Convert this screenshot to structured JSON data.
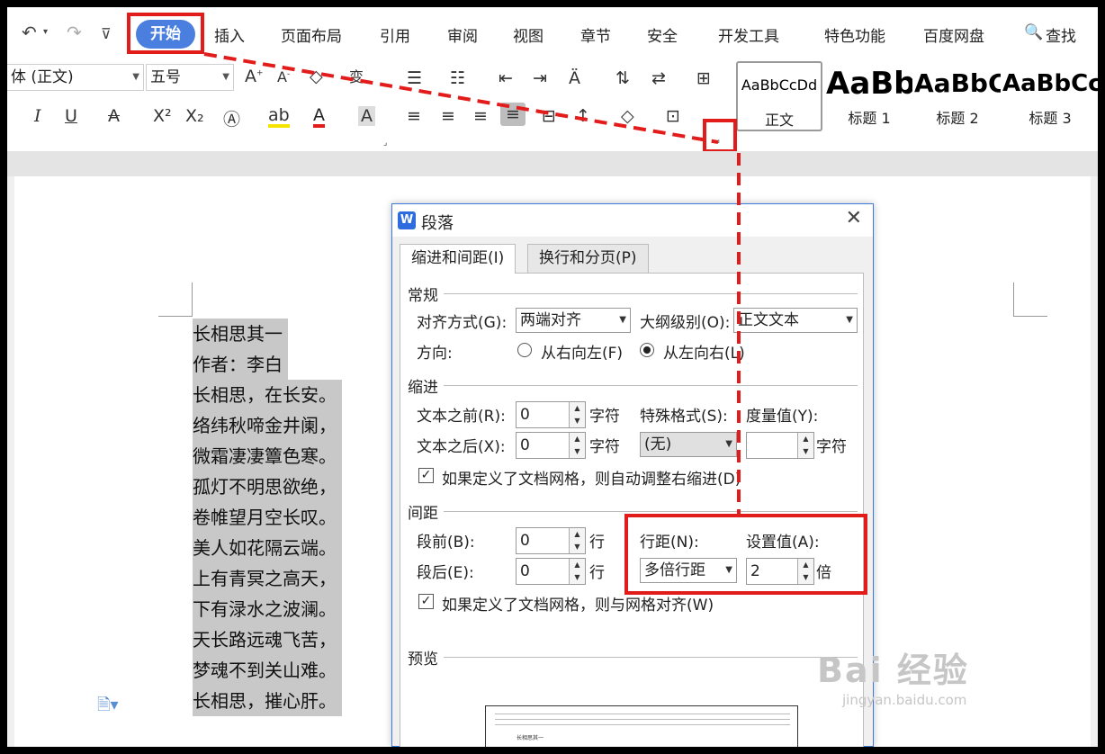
{
  "ribbon_tabs": {
    "home": "开始",
    "others": [
      "插入",
      "页面布局",
      "引用",
      "审阅",
      "视图",
      "章节",
      "安全",
      "开发工具",
      "特色功能",
      "百度网盘"
    ],
    "search": "查找"
  },
  "quick_access": {
    "undo": "↶",
    "redo": "↷",
    "more": "⊽"
  },
  "font": {
    "family": "体 (正文)",
    "size": "五号"
  },
  "styles": [
    {
      "sample": "AaBbCcDd",
      "name": "正文"
    },
    {
      "sample": "AaBb",
      "name": "标题 1"
    },
    {
      "sample": "AaBbC",
      "name": "标题 2"
    },
    {
      "sample": "AaBbCc",
      "name": "标题 3"
    }
  ],
  "poem": [
    "长相思其一",
    "作者：李白",
    "长相思，在长安。",
    "络纬秋啼金井阑，",
    "微霜凄凄簟色寒。",
    "孤灯不明思欲绝，",
    "卷帷望月空长叹。",
    "美人如花隔云端。",
    "上有青冥之高天，",
    "下有渌水之波澜。",
    "天长路远魂飞苦，",
    "梦魂不到关山难。",
    "长相思，摧心肝。"
  ],
  "dialog": {
    "title": "段落",
    "logo": "W",
    "close": "✕",
    "tabs": [
      "缩进和间距(I)",
      "换行和分页(P)"
    ],
    "general": {
      "header": "常规",
      "align_label": "对齐方式(G):",
      "align_value": "两端对齐",
      "outline_label": "大纲级别(O):",
      "outline_value": "正文文本",
      "direction_label": "方向:",
      "rtl": "从右向左(F)",
      "ltr": "从左向右(L)"
    },
    "indent": {
      "header": "缩进",
      "before_label": "文本之前(R):",
      "before_value": "0",
      "after_label": "文本之后(X):",
      "after_value": "0",
      "unit": "字符",
      "special_label": "特殊格式(S):",
      "special_value": "(无)",
      "measure_label": "度量值(Y):",
      "measure_value": "",
      "auto_adjust": "如果定义了文档网格，则自动调整右缩进(D)"
    },
    "spacing": {
      "header": "间距",
      "before_label": "段前(B):",
      "before_value": "0",
      "after_label": "段后(E):",
      "after_value": "0",
      "unit": "行",
      "line_label": "行距(N):",
      "line_value": "多倍行距",
      "set_label": "设置值(A):",
      "set_value": "2",
      "set_unit": "倍",
      "grid_align": "如果定义了文档网格，则与网格对齐(W)"
    },
    "preview": {
      "header": "预览",
      "sample": "长相思其一"
    }
  },
  "watermark": {
    "big": "Bai 经验",
    "small": "jingyan.baidu.com"
  },
  "highlight_color": "#e21b1b",
  "accent_color": "#4a7fe0"
}
